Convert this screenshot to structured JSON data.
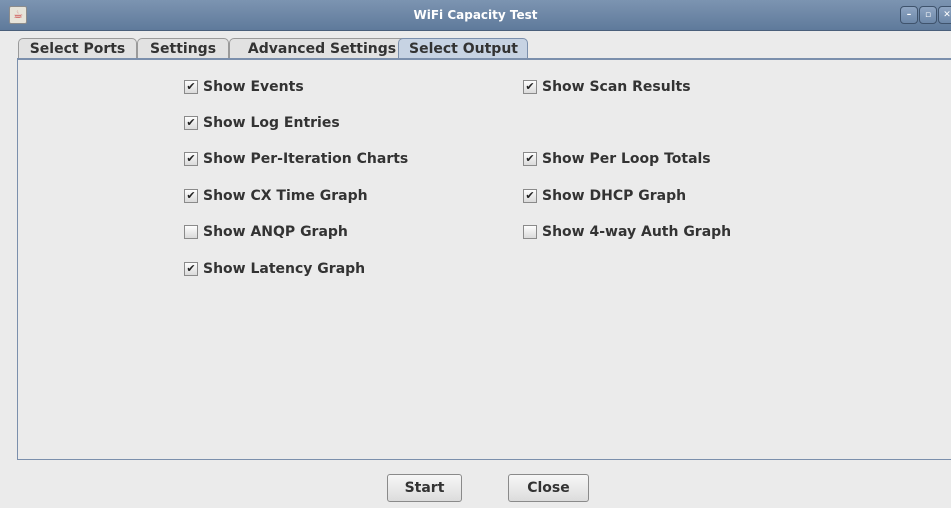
{
  "window": {
    "title": "WiFi Capacity Test",
    "controls": [
      "minimize",
      "maximize",
      "close"
    ]
  },
  "tabs": [
    {
      "label": "Select Ports",
      "selected": false
    },
    {
      "label": "Settings",
      "selected": false
    },
    {
      "label": "Advanced Settings",
      "selected": false
    },
    {
      "label": "Select Output",
      "selected": true
    }
  ],
  "options": [
    {
      "label": "Show Events",
      "checked": true
    },
    {
      "label": "Show Scan Results",
      "checked": true
    },
    {
      "label": "Show Log Entries",
      "checked": true
    },
    {
      "label": "Show Per-Iteration Charts",
      "checked": true
    },
    {
      "label": "Show Per Loop Totals",
      "checked": true
    },
    {
      "label": "Show CX Time Graph",
      "checked": true
    },
    {
      "label": "Show DHCP Graph",
      "checked": true
    },
    {
      "label": "Show ANQP Graph",
      "checked": false
    },
    {
      "label": "Show 4-way Auth Graph",
      "checked": false
    },
    {
      "label": "Show Latency Graph",
      "checked": true
    }
  ],
  "buttons": {
    "start": "Start",
    "close": "Close"
  }
}
